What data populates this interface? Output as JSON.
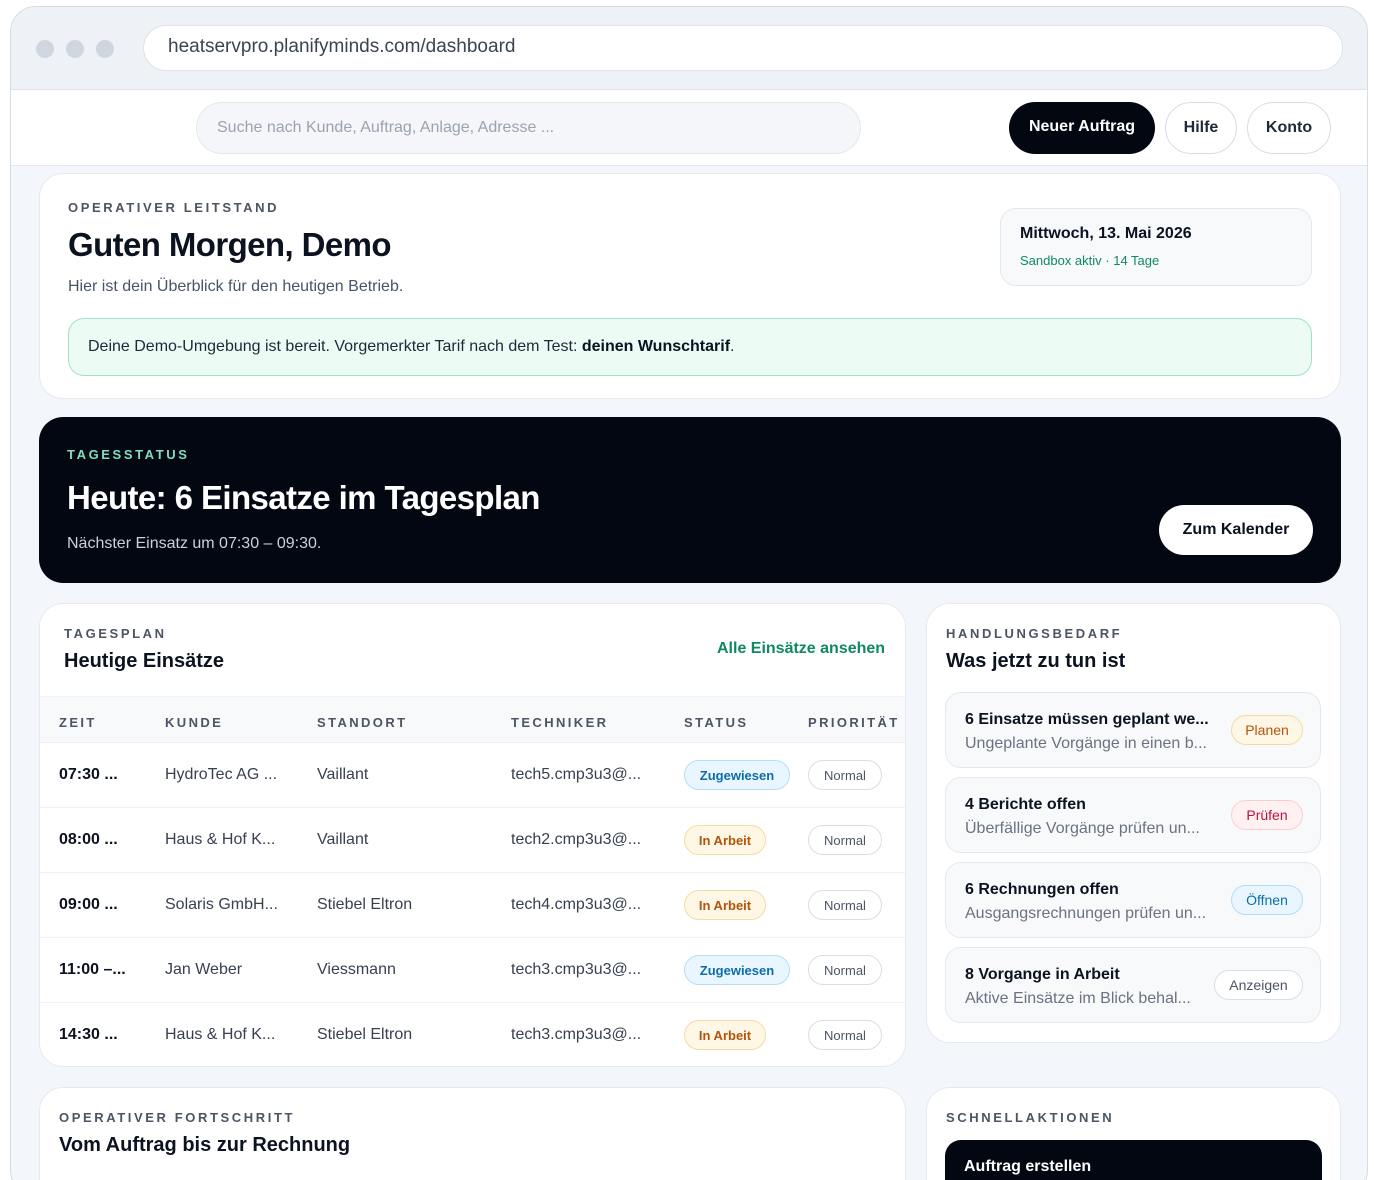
{
  "browser": {
    "url": "heatservpro.planifyminds.com/dashboard"
  },
  "topbar": {
    "search_placeholder": "Suche nach Kunde, Auftrag, Anlage, Adresse ...",
    "new_order_label": "Neuer Auftrag",
    "help_label": "Hilfe",
    "account_label": "Konto"
  },
  "welcome": {
    "eyebrow": "OPERATIVER LEITSTAND",
    "title": "Guten Morgen, Demo",
    "subtitle": "Hier ist dein Überblick für den heutigen Betrieb.",
    "date": "Mittwoch, 13. Mai 2026",
    "sandbox": "Sandbox aktiv · 14 Tage",
    "notice_text": "Deine Demo-Umgebung ist bereit. Vorgemerkter Tarif nach dem Test: ",
    "notice_bold": "deinen Wunschtarif",
    "notice_end": "."
  },
  "hero": {
    "eyebrow": "TAGESSTATUS",
    "title": "Heute: 6 Einsatze im Tagesplan",
    "subtitle": "Nächster Einsatz um 07:30 – 09:30.",
    "calendar_button": "Zum Kalender"
  },
  "schedule": {
    "eyebrow": "TAGESPLAN",
    "title": "Heutige Einsätze",
    "view_all": "Alle Einsätze ansehen",
    "columns": [
      "ZEIT",
      "KUNDE",
      "STANDORT",
      "TECHNIKER",
      "STATUS",
      "PRIORITÄT"
    ],
    "rows": [
      {
        "time": "07:30 ...",
        "customer": "HydroTec AG ...",
        "location": "Vaillant",
        "tech": "tech5.cmp3u3@...",
        "status": "Zugewiesen",
        "priority": "Normal"
      },
      {
        "time": "08:00 ...",
        "customer": "Haus & Hof K...",
        "location": "Vaillant",
        "tech": "tech2.cmp3u3@...",
        "status": "In Arbeit",
        "priority": "Normal"
      },
      {
        "time": "09:00 ...",
        "customer": "Solaris GmbH...",
        "location": "Stiebel Eltron",
        "tech": "tech4.cmp3u3@...",
        "status": "In Arbeit",
        "priority": "Normal"
      },
      {
        "time": "11:00 –...",
        "customer": "Jan Weber",
        "location": "Viessmann",
        "tech": "tech3.cmp3u3@...",
        "status": "Zugewiesen",
        "priority": "Normal"
      },
      {
        "time": "14:30 ...",
        "customer": "Haus & Hof K...",
        "location": "Stiebel Eltron",
        "tech": "tech3.cmp3u3@...",
        "status": "In Arbeit",
        "priority": "Normal"
      }
    ]
  },
  "actions": {
    "eyebrow": "HANDLUNGSBEDARF",
    "title": "Was jetzt zu tun ist",
    "items": [
      {
        "title": "6 Einsatze müssen geplant we...",
        "subtitle": "Ungeplante Vorgänge in einen b...",
        "badge": "Planen"
      },
      {
        "title": "4 Berichte offen",
        "subtitle": "Überfällige Vorgänge prüfen un...",
        "badge": "Prüfen"
      },
      {
        "title": "6 Rechnungen offen",
        "subtitle": "Ausgangsrechnungen prüfen un...",
        "badge": "Öffnen"
      },
      {
        "title": "8 Vorgange in Arbeit",
        "subtitle": "Aktive Einsätze im Blick behal...",
        "badge": "Anzeigen"
      }
    ]
  },
  "progress": {
    "eyebrow": "OPERATIVER FORTSCHRITT",
    "title": "Vom Auftrag bis zur Rechnung"
  },
  "quick": {
    "eyebrow": "SCHNELLAKTIONEN",
    "create_order": "Auftrag erstellen"
  },
  "colors": {
    "accent_green": "#0f8a5f",
    "dark": "#030712",
    "assigned": "#0c6ea8",
    "in_progress": "#b45309",
    "check": "#be123c"
  }
}
